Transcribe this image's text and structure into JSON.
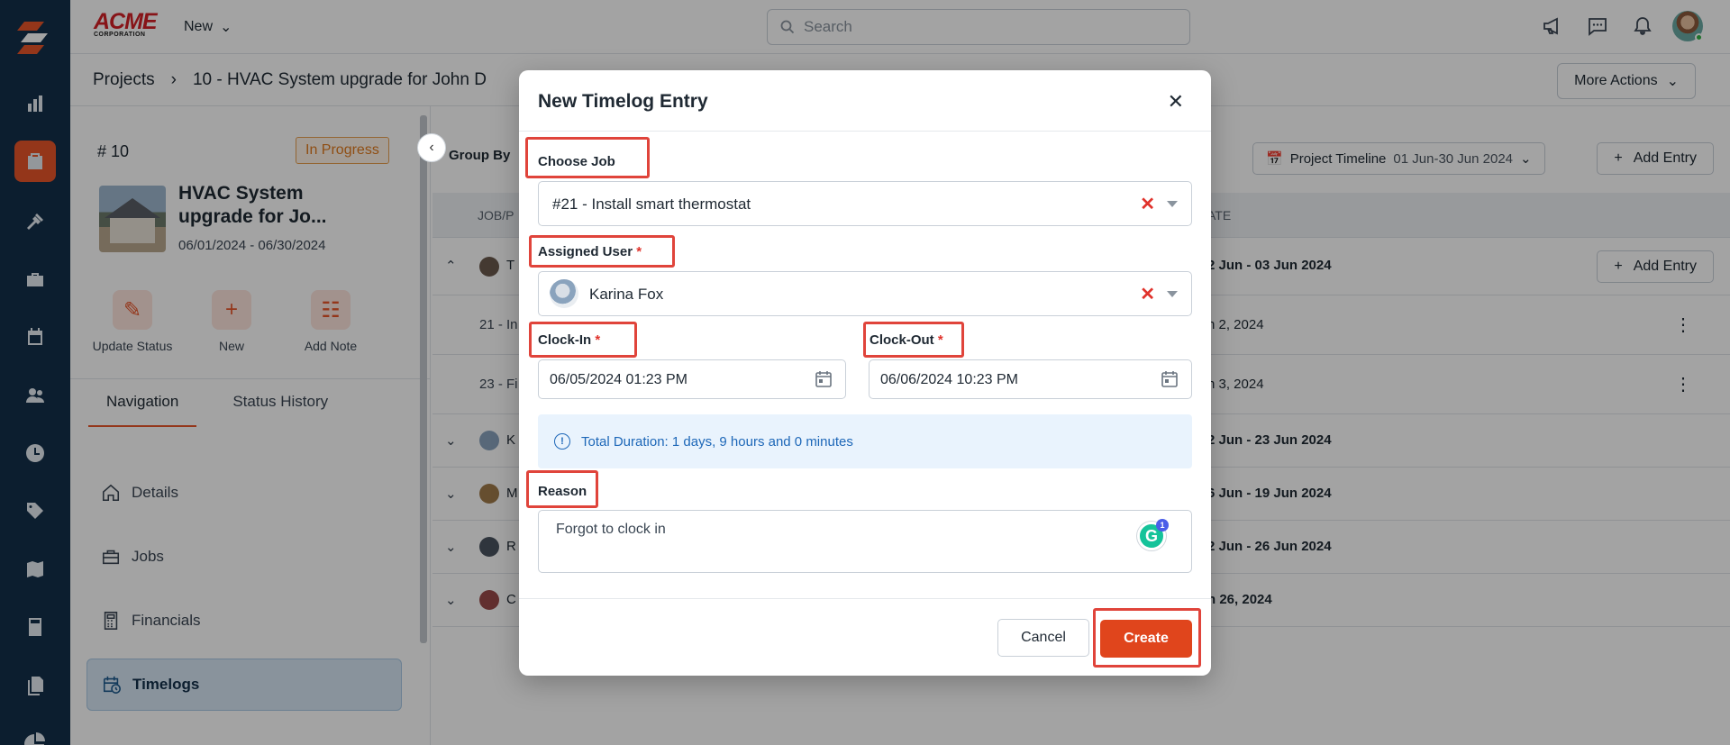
{
  "header": {
    "brand_top": "ACME",
    "brand_bottom": "CORPORATION",
    "new_label": "New",
    "search_placeholder": "Search"
  },
  "breadcrumb": {
    "root": "Projects",
    "current": "10 - HVAC System upgrade for John D",
    "more_actions": "More Actions"
  },
  "project": {
    "number": "# 10",
    "status": "In Progress",
    "title": "HVAC System upgrade for Jo...",
    "dates": "06/01/2024 - 06/30/2024",
    "actions": [
      {
        "label": "Update Status",
        "icon": "pencil-icon"
      },
      {
        "label": "New",
        "icon": "plus-icon"
      },
      {
        "label": "Add Note",
        "icon": "note-add-icon"
      }
    ],
    "tabs": [
      "Navigation",
      "Status History"
    ],
    "nav_items": [
      {
        "label": "Details",
        "icon": "home-icon"
      },
      {
        "label": "Jobs",
        "icon": "briefcase-icon"
      },
      {
        "label": "Financials",
        "icon": "calculator-icon"
      },
      {
        "label": "Timelogs",
        "icon": "calendar-clock-icon",
        "active": true
      }
    ]
  },
  "content": {
    "group_by": "Group By",
    "timeline_label": "Project Timeline",
    "timeline_range": "01 Jun-30 Jun 2024",
    "add_entry": "Add Entry",
    "col_job": "JOB/P",
    "col_date": "ATE",
    "rows": [
      {
        "initial": "T",
        "date": "2 Jun - 03 Jun 2024",
        "expanded": true
      },
      {
        "sub": "21 - In",
        "date": "n 2, 2024"
      },
      {
        "sub": "23 - Fi",
        "date": "n 3, 2024"
      },
      {
        "initial": "K",
        "date": "2 Jun - 23 Jun 2024"
      },
      {
        "initial": "M",
        "date": "6 Jun - 19 Jun 2024"
      },
      {
        "initial": "R",
        "date": "2 Jun - 26 Jun 2024"
      },
      {
        "initial": "C",
        "date": "n 26, 2024"
      }
    ]
  },
  "modal": {
    "title": "New Timelog Entry",
    "choose_job_label": "Choose Job",
    "choose_job_value": "#21 - Install smart thermostat",
    "assigned_user_label": "Assigned User",
    "assigned_user_value": "Karina Fox",
    "clock_in_label": "Clock-In",
    "clock_in_value": "06/05/2024 01:23 PM",
    "clock_out_label": "Clock-Out",
    "clock_out_value": "06/06/2024 10:23 PM",
    "required_mark": "*",
    "duration_text": "Total Duration: 1 days, 9 hours and 0 minutes",
    "reason_label": "Reason",
    "reason_value": "Forgot to clock in",
    "grammarly_count": "1",
    "cancel_label": "Cancel",
    "create_label": "Create"
  },
  "colors": {
    "rail": "#14304a",
    "accent": "#e8552a",
    "highlight": "#e0443b",
    "info_text": "#1d67b8"
  }
}
